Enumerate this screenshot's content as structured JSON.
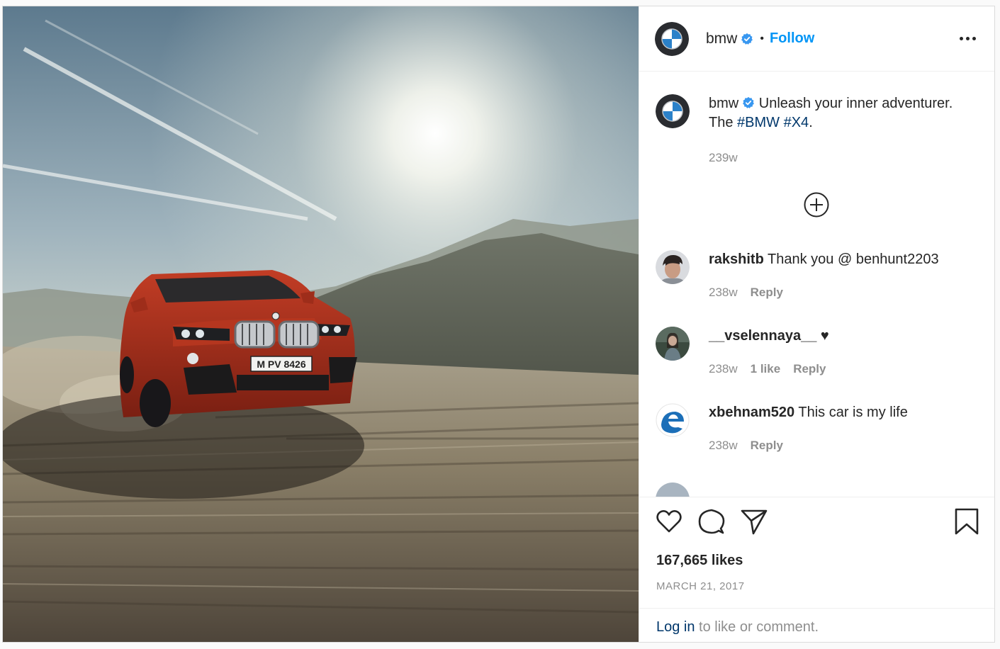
{
  "post": {
    "author": "bmw",
    "follow_label": "Follow",
    "separator": "•",
    "caption": {
      "username": "bmw",
      "text_before": "Unleash your inner adventurer. The ",
      "hashtag_1": "#BMW",
      "space": " ",
      "hashtag_2": "#X4",
      "text_after": ".",
      "age": "239w"
    },
    "photo": {
      "license_plate": "M PV 8426"
    },
    "comments": [
      {
        "username": "rakshitb",
        "text": "Thank you @ benhunt2203",
        "age": "238w",
        "likes": "",
        "reply": "Reply"
      },
      {
        "username": "__vselennaya__",
        "text": "♥",
        "age": "238w",
        "likes": "1 like",
        "reply": "Reply"
      },
      {
        "username": "xbehnam520",
        "text": "This car is my life",
        "age": "238w",
        "likes": "",
        "reply": "Reply"
      }
    ],
    "likes": "167,665 likes",
    "date": "MARCH 21, 2017",
    "login_link": "Log in",
    "login_text": " to like or comment."
  },
  "icons": {
    "like": "heart-icon",
    "comment": "comment-bubble-icon",
    "share": "paper-plane-icon",
    "save": "bookmark-icon",
    "more": "more-options-icon",
    "load_more": "plus-circle-icon",
    "verified": "verified-badge-icon"
  },
  "colors": {
    "link_blue": "#0095f6",
    "hashtag": "#00376b",
    "verified": "#3897f0",
    "secondary_text": "#8e8e8e",
    "car_red": "#a8301d"
  }
}
